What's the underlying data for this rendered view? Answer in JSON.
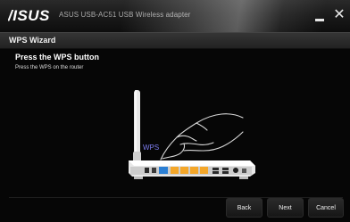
{
  "window": {
    "brand": "ASUS",
    "title": "ASUS USB-AC51 USB Wireless adapter"
  },
  "wizard": {
    "header": "WPS Wizard",
    "step_title": "Press the WPS button",
    "step_description": "Press the WPS on the router",
    "illustration_label": "WPS"
  },
  "buttons": {
    "back": "Back",
    "next": "Next",
    "cancel": "Cancel"
  },
  "colors": {
    "background": "#060606",
    "led_orange": "#f4a72a",
    "wps_button_blue": "#2b7fd4",
    "label_purple": "#7d7df0"
  },
  "icons": {
    "minimize": "minimize-icon",
    "close": "close-icon"
  }
}
